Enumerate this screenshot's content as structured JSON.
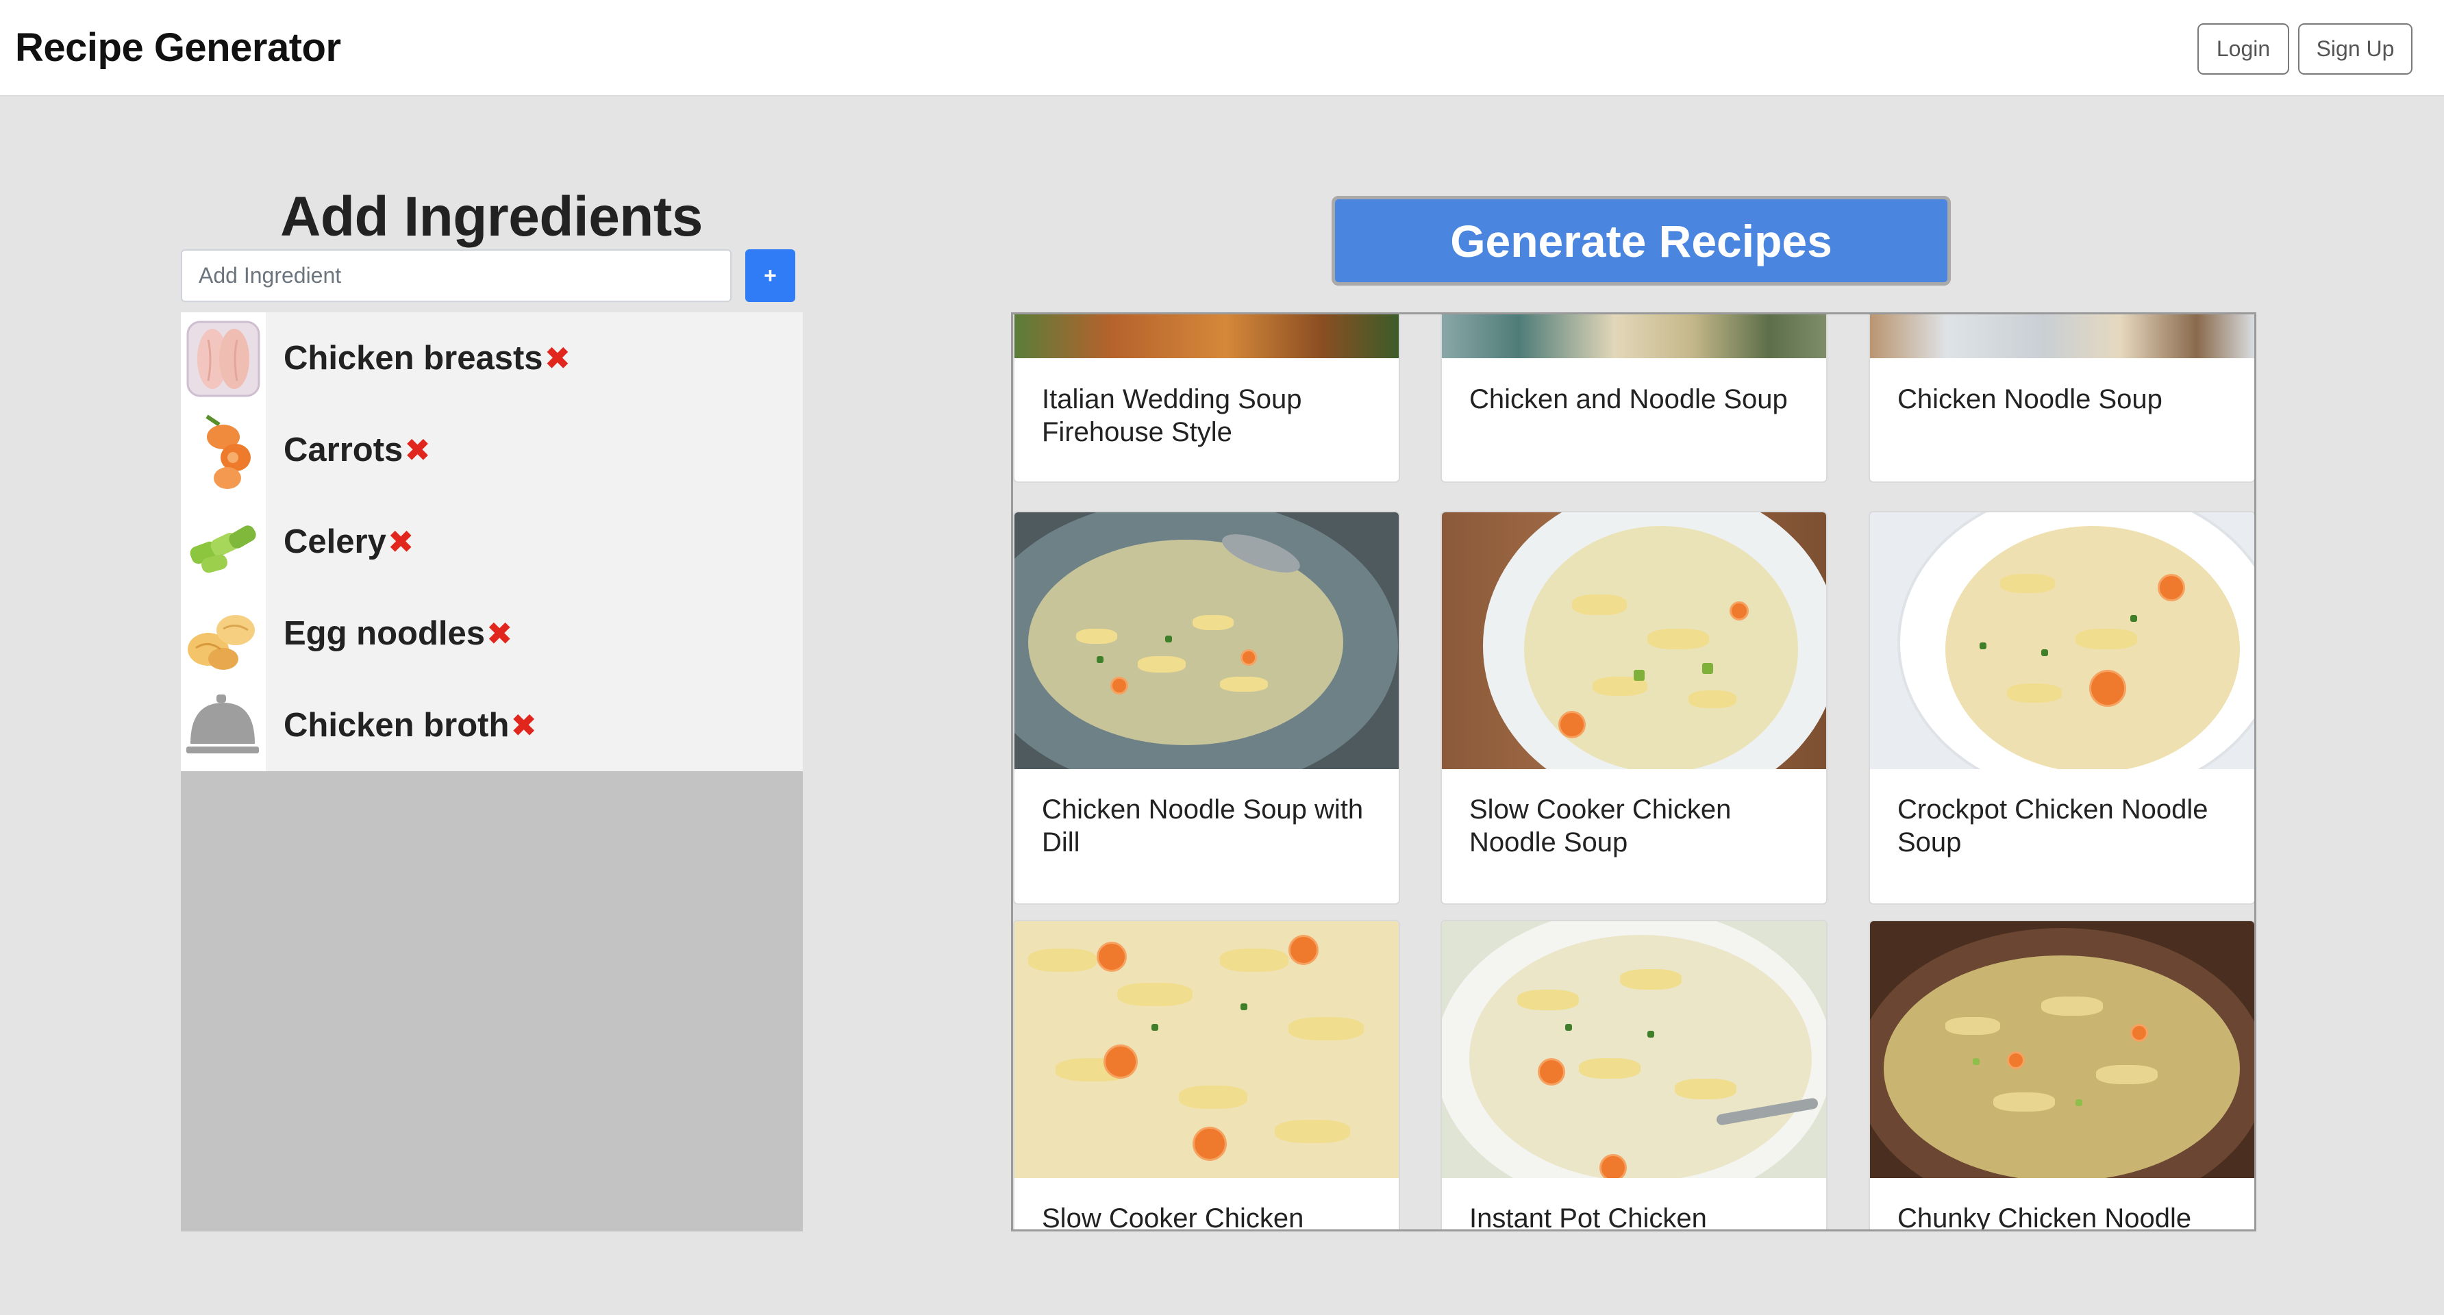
{
  "navbar": {
    "brand": "Recipe Generator",
    "login_label": "Login",
    "signup_label": "Sign Up"
  },
  "ingredients_panel": {
    "title": "Add Ingredients",
    "input_placeholder": "Add Ingredient",
    "input_value": "",
    "add_button_label": "+",
    "items": [
      {
        "label": "Chicken breasts",
        "remove": "✖",
        "icon": "chicken-breast-icon"
      },
      {
        "label": "Carrots",
        "remove": "✖",
        "icon": "carrot-icon"
      },
      {
        "label": "Celery",
        "remove": "✖",
        "icon": "celery-icon"
      },
      {
        "label": "Egg noodles",
        "remove": "✖",
        "icon": "egg-noodles-icon"
      },
      {
        "label": "Chicken broth",
        "remove": "✖",
        "icon": "food-cloche-icon"
      }
    ]
  },
  "recipes_panel": {
    "generate_label": "Generate Recipes",
    "cards": [
      {
        "title": "Italian Wedding Soup Firehouse Style"
      },
      {
        "title": "Chicken and Noodle Soup"
      },
      {
        "title": "Chicken Noodle Soup"
      },
      {
        "title": "Chicken Noodle Soup with Dill"
      },
      {
        "title": "Slow Cooker Chicken Noodle Soup"
      },
      {
        "title": "Crockpot Chicken Noodle Soup"
      },
      {
        "title": "Slow Cooker Chicken"
      },
      {
        "title": "Instant Pot Chicken"
      },
      {
        "title": "Chunky Chicken Noodle"
      }
    ]
  },
  "colors": {
    "primary_blue": "#2f7cf6",
    "generate_blue": "#4a85e0",
    "remove_red": "#e1271d",
    "page_bg": "#e4e4e4"
  }
}
